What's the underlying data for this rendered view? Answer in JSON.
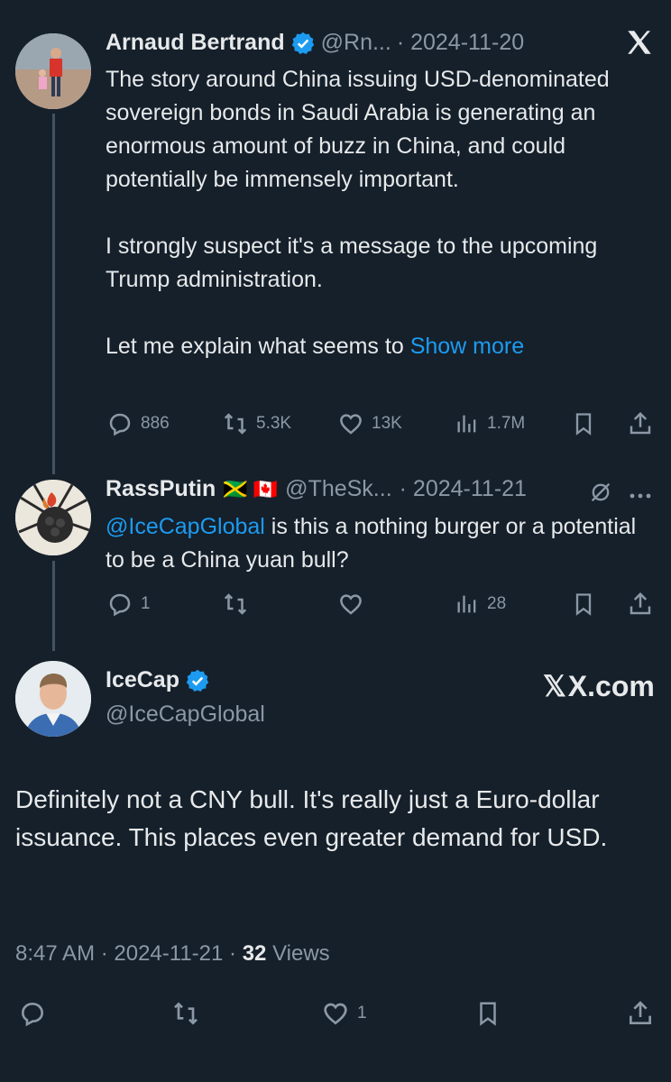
{
  "tweet1": {
    "name": "Arnaud Bertrand",
    "handle": "@Rn...",
    "date": "· 2024-11-20",
    "text1": "The story around China issuing USD-denominated sovereign bonds in Saudi Arabia is generating an enormous amount of buzz in China, and could potentially be immensely important.",
    "text2": "I strongly suspect it's a message to the upcoming Trump administration.",
    "text3": "Let me explain what seems to",
    "show_more": "Show more",
    "replies": "886",
    "reposts": "5.3K",
    "likes": "13K",
    "views": "1.7M"
  },
  "tweet2": {
    "name": "RassPutin",
    "flags": "🇯🇲 🇨🇦",
    "handle": "@TheSk...",
    "date": "· 2024-11-21",
    "mention": "@IceCapGlobal",
    "text": " is this a nothing burger or a potential to be a China yuan bull?",
    "replies": "1",
    "reposts": "",
    "likes": "",
    "views": "28"
  },
  "tweet3": {
    "name": "IceCap",
    "handle": "@IceCapGlobal",
    "text": "Definitely not a CNY bull. It's really just a Euro-dollar issuance. This places even greater demand for USD.",
    "time": "8:47 AM · 2024-11-21 · ",
    "views_count": "32",
    "views_label": " Views",
    "likes": "1"
  },
  "brand": {
    "x_logo": "𝕏",
    "watermark": "X.com"
  },
  "colors": {
    "background": "#15202b",
    "accent": "#1d9bf0",
    "muted": "#8b98a5"
  }
}
